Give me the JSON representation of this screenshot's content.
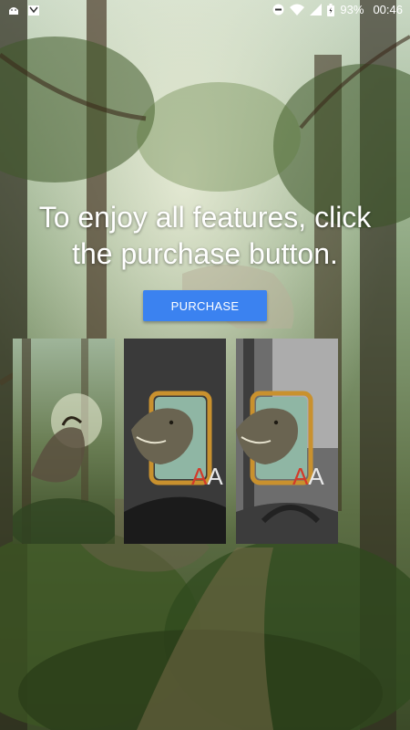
{
  "status_bar": {
    "battery": "93%",
    "time": "00:46",
    "icons": [
      "android-icon",
      "notification-icon",
      "do-not-disturb-icon",
      "wifi-icon",
      "signal-icon",
      "battery-icon"
    ]
  },
  "message": {
    "line1": "To enjoy all features, click",
    "line2": "the purchase button."
  },
  "purchase_button": {
    "label": "PURCHASE",
    "color": "#3b82f0"
  },
  "screenshots": [
    {
      "name": "forest-dinosaur-screenshot"
    },
    {
      "name": "app-icon-dark-screenshot"
    },
    {
      "name": "app-icon-light-screenshot"
    }
  ],
  "app_icon_letters": "AA"
}
